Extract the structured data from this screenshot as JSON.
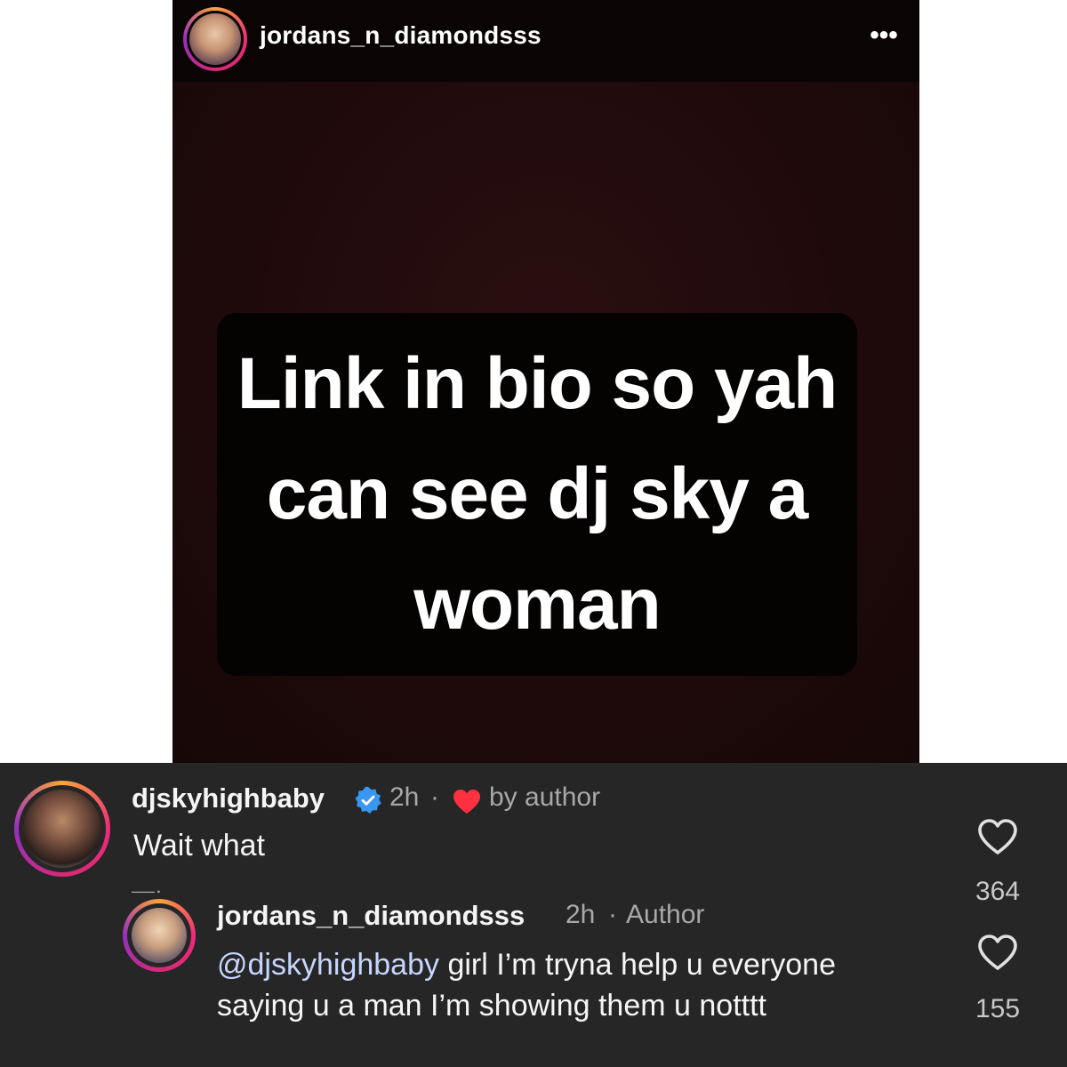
{
  "story": {
    "username": "jordans_n_diamondsss",
    "more_label": "•••",
    "text": "Link in bio so yah can see dj sky a woman"
  },
  "comments": [
    {
      "username": "djskyhighbaby",
      "time": "2h",
      "separator": "·",
      "liked_by": "by author",
      "text": "Wait what",
      "likes": "364"
    },
    {
      "username": "jordans_n_diamondsss",
      "time": "2h",
      "separator": "·",
      "role": "Author",
      "mention": "@djskyhighbaby",
      "text": " girl I’m tryna help u everyone saying u a man I’m showing them u notttt",
      "likes": "155"
    }
  ],
  "icons": {
    "verified": "verified-badge-icon",
    "heart_filled": "heart-filled-icon",
    "like": "heart-outline-icon"
  },
  "colors": {
    "verified": "#3897f0",
    "heart": "#ff3040",
    "comment_bg": "#262626"
  }
}
